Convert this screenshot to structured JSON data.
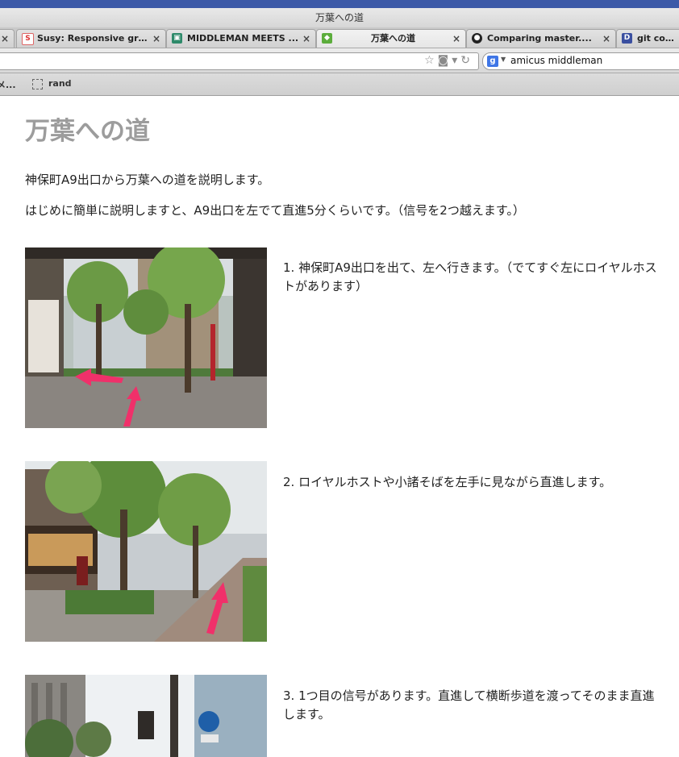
{
  "window": {
    "title": "万葉への道"
  },
  "tabs": [
    {
      "label": "Susy: Responsive gri...",
      "icon": "susy-s-icon",
      "active": false
    },
    {
      "label": "MIDDLEMAN MEETS ...",
      "icon": "middleman-icon",
      "active": false
    },
    {
      "label": "万葉への道",
      "icon": "evernote-icon",
      "active": true
    },
    {
      "label": "Comparing master....",
      "icon": "github-icon",
      "active": false
    },
    {
      "label": "git comm",
      "icon": "d-icon",
      "active": false
    }
  ],
  "toolbar": {
    "search_query": "amicus middleman",
    "search_engine_icon": "google-icon"
  },
  "bookmarks": [
    {
      "label": "メ..."
    },
    {
      "label": "rand"
    }
  ],
  "page": {
    "title": "万葉への道",
    "intro1": "神保町A9出口から万葉への道を説明します。",
    "intro2": "はじめに簡単に説明しますと、A9出口を左でて直進5分くらいです。（信号を2つ越えます。）",
    "steps": [
      {
        "text": "1. 神保町A9出口を出て、左へ行きます。（でてすぐ左にロイヤルホストがあります）"
      },
      {
        "text": "2. ロイヤルホストや小諸そばを左手に見ながら直進します。"
      },
      {
        "text": "3. 1つ目の信号があります。直進して横断歩道を渡ってそのまま直進します。"
      }
    ]
  },
  "colors": {
    "arrow": "#f0306a",
    "heading": "#9c9c9c"
  }
}
